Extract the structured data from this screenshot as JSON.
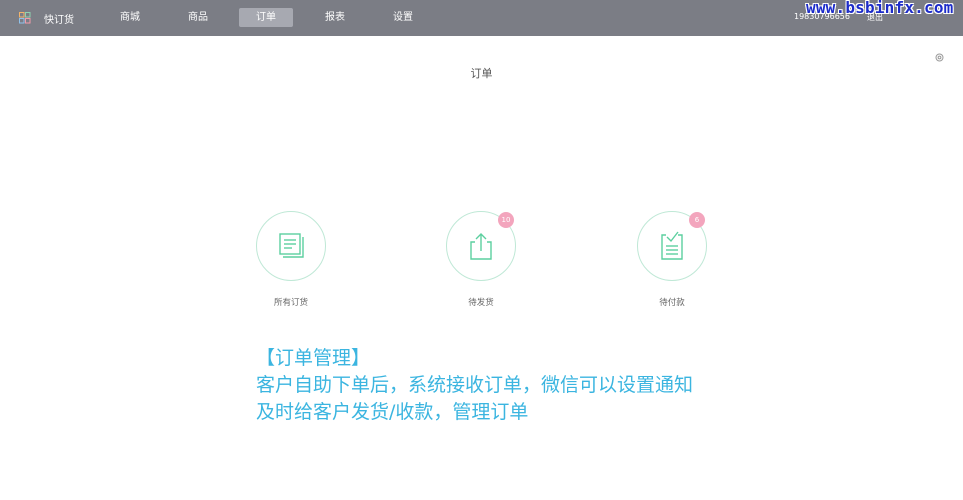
{
  "header": {
    "brand": "快订货",
    "nav": [
      {
        "label": "商城",
        "active": false
      },
      {
        "label": "商品",
        "active": false
      },
      {
        "label": "订单",
        "active": true
      },
      {
        "label": "报表",
        "active": false
      },
      {
        "label": "设置",
        "active": false
      }
    ],
    "phone": "19830796656",
    "logout": "退出"
  },
  "watermark": "www.bsbinfx.com",
  "page": {
    "title": "订单"
  },
  "cards": [
    {
      "label": "所有订货",
      "icon": "document-icon",
      "badge": null
    },
    {
      "label": "待发货",
      "icon": "share-upload-icon",
      "badge": "10"
    },
    {
      "label": "待付款",
      "icon": "checklist-icon",
      "badge": "6"
    }
  ],
  "promo": {
    "line1": "【订单管理】",
    "line2": "客户自助下单后，系统接收订单，微信可以设置通知",
    "line3": "及时给客户发货/收款，管理订单"
  },
  "colors": {
    "topbar": "#7b7d85",
    "nav_active": "#a7a9b1",
    "icon_green": "#5ccf9f",
    "badge": "#f3a5bd",
    "promo_text": "#3bb5e0",
    "watermark": "#1d2cc9"
  }
}
